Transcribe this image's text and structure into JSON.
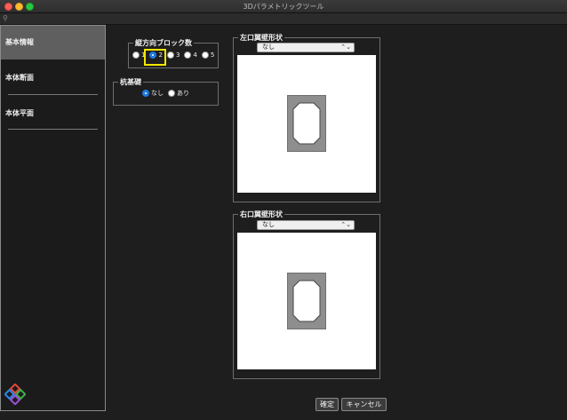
{
  "window": {
    "title": "3Dパラメトリックツール"
  },
  "sidebar": {
    "items": [
      {
        "label": "基本情報"
      },
      {
        "label": "本体断面"
      },
      {
        "label": "本体平面"
      }
    ]
  },
  "block_count": {
    "title": "縦方向ブロック数",
    "options": [
      "1",
      "2",
      "3",
      "4",
      "5"
    ],
    "selected": "2"
  },
  "pile_foundation": {
    "title": "杭基礎",
    "options": [
      "なし",
      "あり"
    ],
    "selected": "なし"
  },
  "left_wing": {
    "title": "左口翼壁形状",
    "select_value": "なし"
  },
  "right_wing": {
    "title": "右口翼壁形状",
    "select_value": "なし"
  },
  "buttons": {
    "confirm": "確定",
    "cancel": "キャンセル"
  },
  "colors": {
    "accent": "#1f7ae0",
    "highlight": "#f2e600",
    "active_sidebar": "#5f5f5f"
  }
}
